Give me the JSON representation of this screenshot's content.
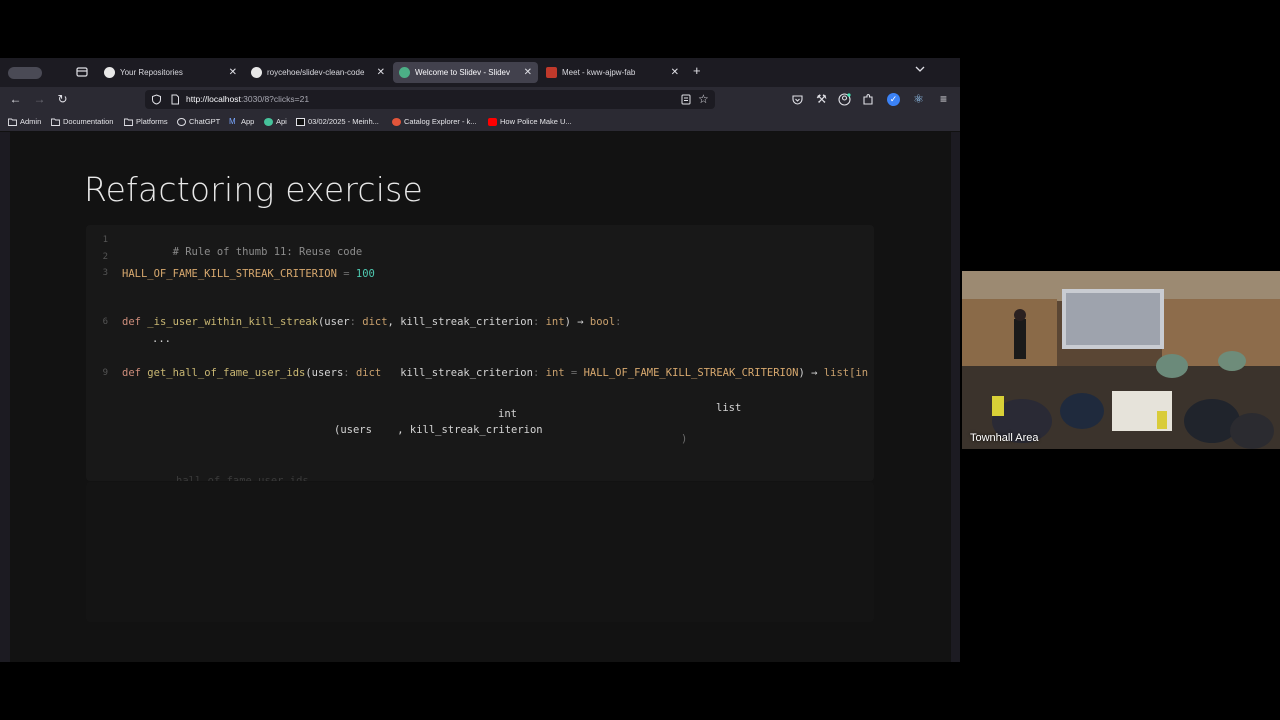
{
  "browser": {
    "tabs": [
      {
        "title": "Your Repositories",
        "icon": "github-icon",
        "active": false
      },
      {
        "title": "roycehoe/slidev-clean-code",
        "icon": "github-icon",
        "active": false
      },
      {
        "title": "Welcome to Slidev - Slidev",
        "icon": "slidev-icon",
        "active": true
      },
      {
        "title": "Meet - kww-ajpw-fab",
        "icon": "meet-icon",
        "active": false
      }
    ],
    "new_tab": "+",
    "url_host": "http://localhost",
    "url_rest": ":3030/8?clicks=21",
    "bookmarks": [
      {
        "label": "Admin",
        "icon": "folder-icon"
      },
      {
        "label": "Documentation",
        "icon": "folder-icon"
      },
      {
        "label": "Platforms",
        "icon": "folder-icon"
      },
      {
        "label": "ChatGPT",
        "icon": "chatgpt-icon"
      },
      {
        "label": "App",
        "icon": "app-icon"
      },
      {
        "label": "Api",
        "icon": "api-icon"
      },
      {
        "label": "03/02/2025 - Meinh...",
        "icon": "page-icon"
      },
      {
        "label": "Catalog Explorer - k...",
        "icon": "catalog-icon"
      },
      {
        "label": "How Police Make U...",
        "icon": "youtube-icon"
      }
    ]
  },
  "slide": {
    "title": "Refactoring exercise",
    "line_numbers": [
      "1",
      "2",
      "3",
      "6",
      "9"
    ],
    "code": {
      "l1": "# Rule of thumb 11: Reuse code",
      "l3_const": "HALL_OF_FAME_KILL_STREAK_CRITERION",
      "l3_eq": " = ",
      "l3_num": "100",
      "l6_def": "def ",
      "l6_fn": "_is_user_within_kill_streak",
      "l6_p1": "(user",
      "l6_c1": ": ",
      "l6_t1": "dict",
      "l6_p2": ", kill_streak_criterion",
      "l6_c2": ": ",
      "l6_t2": "int",
      "l6_arrow": ") → ",
      "l6_ret": "bool",
      "l6_end": ":",
      "l7": "...",
      "l9_def": "def ",
      "l9_fn": "get_hall_of_fame_user_ids",
      "l9_p1": "(users",
      "l9_c1": ": ",
      "l9_t1": "dict",
      "l9_p2": "kill_streak_criterion",
      "l9_c2": ": ",
      "l9_t2": "int",
      "l9_eq": " = ",
      "l9_const": "HALL_OF_FAME_KILL_STREAK_CRITERION",
      "l9_arrow": ") → ",
      "l9_ret": "list[in",
      "float_int": "int",
      "float_list": "list",
      "float_users": "(users",
      "float_kill": ", kill_streak_criterion",
      "float_paren": ")",
      "ghost_return": "hall_of_fame_user_ids"
    }
  },
  "video": {
    "label": "Townhall Area"
  }
}
